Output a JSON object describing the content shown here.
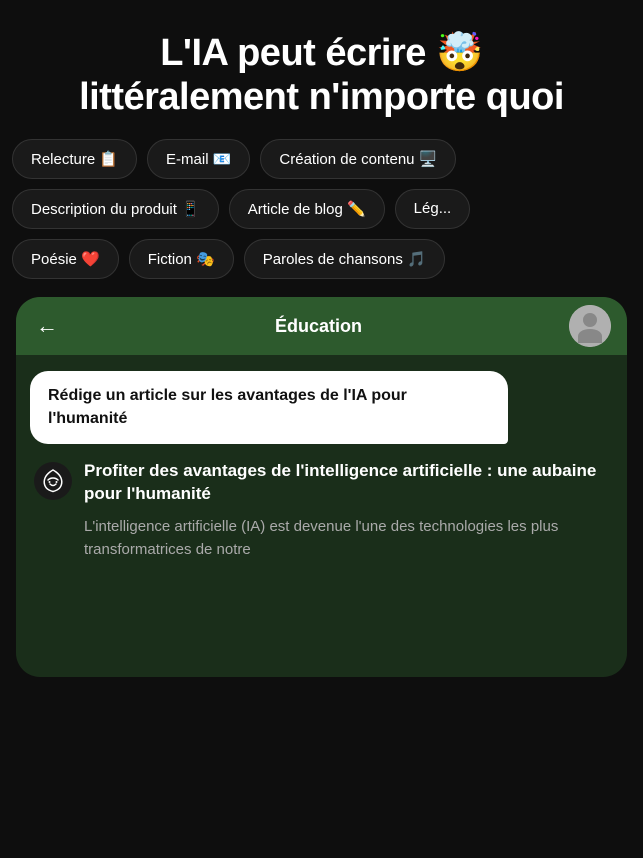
{
  "header": {
    "title_line1": "L'IA peut écrire 🤯",
    "title_line2": "littéralement n'importe quoi"
  },
  "tags": {
    "row1": [
      {
        "label": "Relecture 📋",
        "id": "relecture"
      },
      {
        "label": "E-mail 📧",
        "id": "email"
      },
      {
        "label": "Création de contenu 🖥️",
        "id": "creation-contenu"
      }
    ],
    "row2": [
      {
        "label": "Description du produit 📱",
        "id": "description-produit"
      },
      {
        "label": "Article de blog ✏️",
        "id": "article-blog"
      },
      {
        "label": "Lég...",
        "id": "leg"
      }
    ],
    "row3": [
      {
        "label": "Poésie ❤️",
        "id": "poesie"
      },
      {
        "label": "Fiction 🎭",
        "id": "fiction"
      },
      {
        "label": "Paroles de chansons 🎵",
        "id": "paroles-chansons"
      }
    ]
  },
  "chat": {
    "back_label": "←",
    "title": "Éducation",
    "user_message": "Rédige un article sur les avantages de l'IA pour l'humanité",
    "ai_response_title": "Profiter des avantages de l'intelligence artificielle : une aubaine pour l'humanité",
    "ai_response_text": "L'intelligence artificielle (IA) est devenue l'une des technologies les plus transformatrices de notre"
  }
}
